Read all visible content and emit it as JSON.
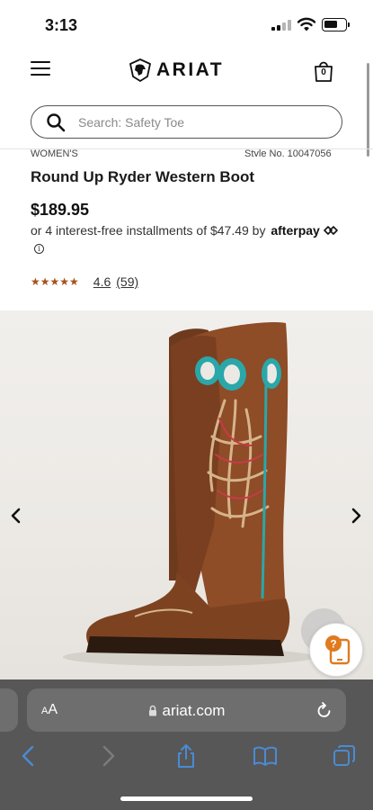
{
  "status_bar": {
    "time": "3:13"
  },
  "header": {
    "logo_text": "ARIAT",
    "cart_count": "0"
  },
  "search": {
    "placeholder": "Search: Safety Toe"
  },
  "product": {
    "category_clipped": "WOMEN'S",
    "style_clipped": "Style No. 10047056",
    "title": "Round Up Ryder Western Boot",
    "price": "$189.95",
    "installments_text": "or 4 interest-free installments of $47.49 by",
    "afterpay_label": "afterpay",
    "rating_stars": "★★★★★",
    "rating_value": "4.6",
    "review_count": "(59)"
  },
  "colors": {
    "star": "#a5521b",
    "browser_bg": "#575757",
    "browser_control": "#6e6e6e",
    "safari_blue": "#4a8bd6",
    "help_orange": "#e07a1f",
    "boot_brown": "#8a4a26",
    "boot_turquoise": "#2aa7a9"
  },
  "browser": {
    "text_size_label_small": "A",
    "text_size_label_large": "A",
    "url": "ariat.com"
  },
  "icons": {
    "menu": "hamburger-icon",
    "cart": "shopping-bag-icon",
    "search": "magnifier-icon",
    "info": "info-icon",
    "prev": "chevron-left-icon",
    "next": "chevron-right-icon",
    "help": "help-chat-icon",
    "lock": "lock-icon",
    "reload": "reload-icon",
    "back": "back-icon",
    "forward": "forward-icon",
    "share": "share-icon",
    "bookmarks": "bookmarks-icon",
    "tabs": "tabs-icon"
  }
}
